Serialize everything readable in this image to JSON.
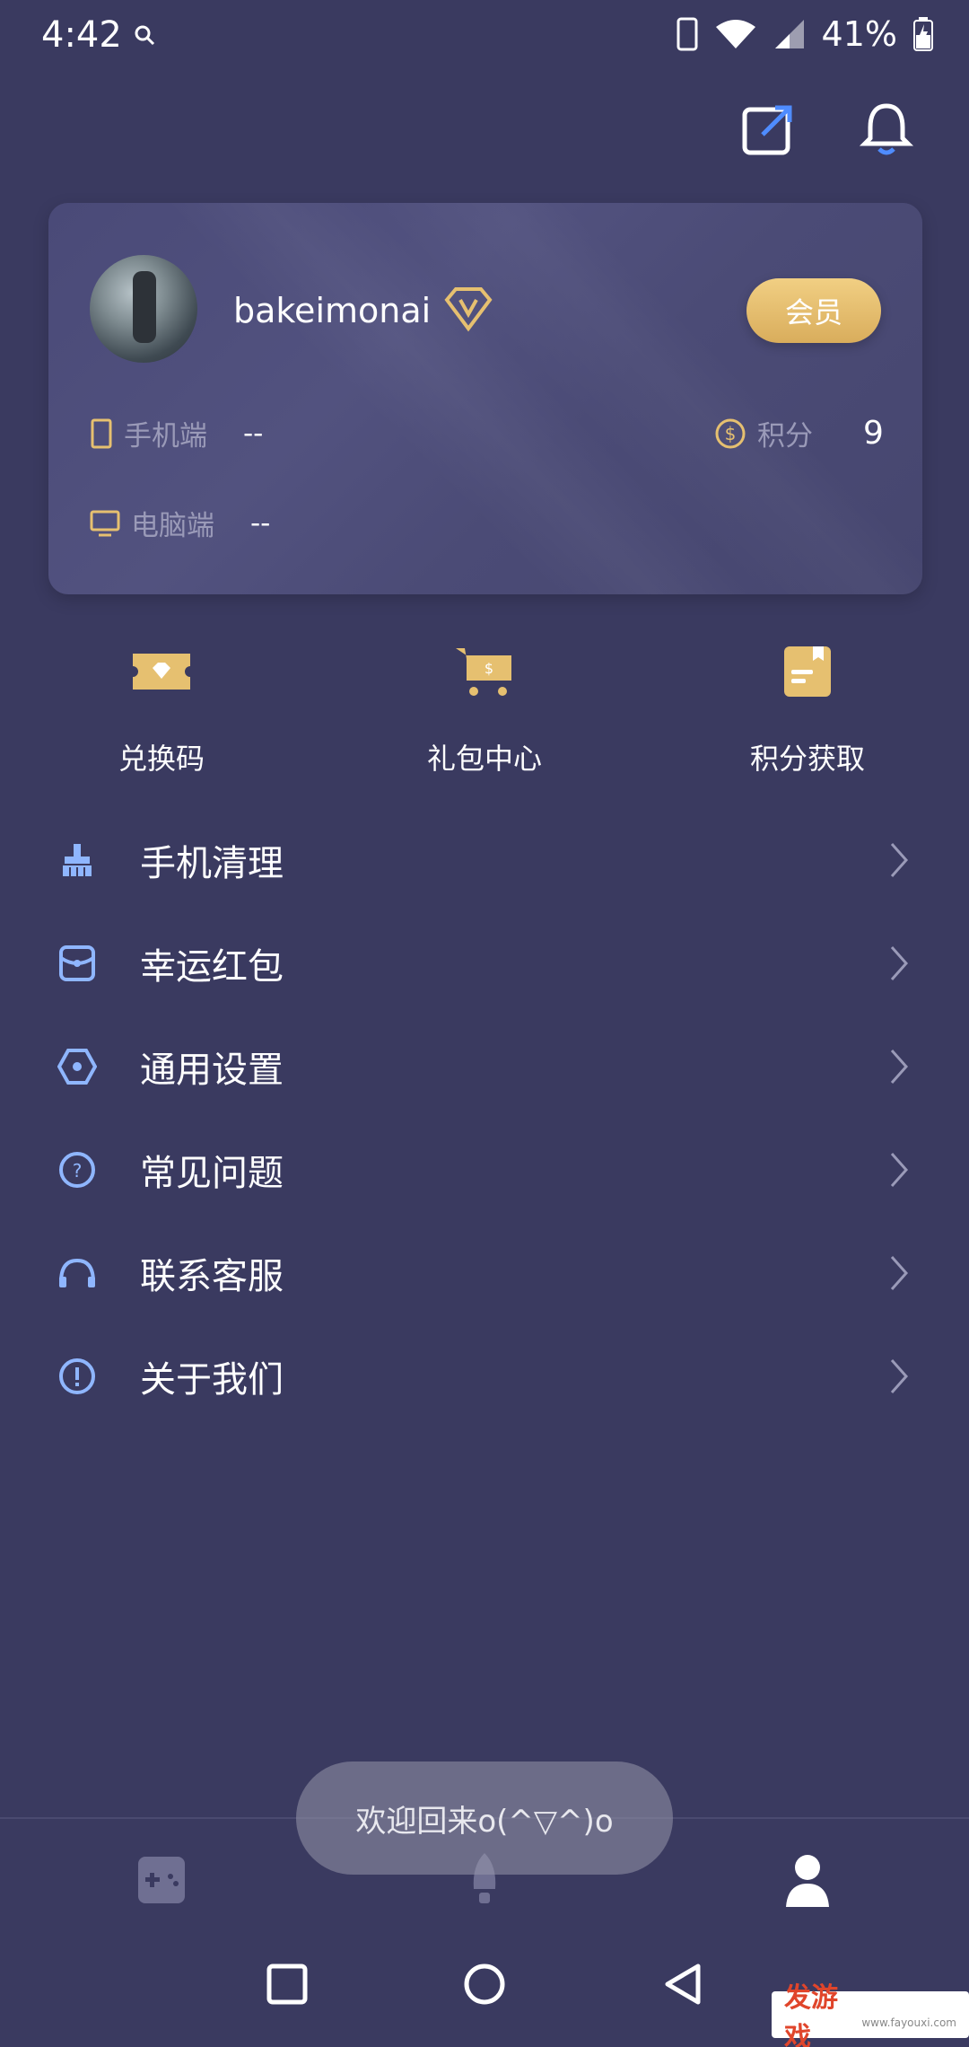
{
  "status_bar": {
    "time": "4:42",
    "battery": "41%"
  },
  "profile": {
    "username": "bakeimonai",
    "member_label": "会员",
    "phone_label": "手机端",
    "phone_value": "--",
    "pc_label": "电脑端",
    "pc_value": "--",
    "points_label": "积分",
    "points_value": "9"
  },
  "quick_actions": [
    {
      "label": "兑换码",
      "icon": "ticket-icon"
    },
    {
      "label": "礼包中心",
      "icon": "cart-icon"
    },
    {
      "label": "积分获取",
      "icon": "notes-icon"
    }
  ],
  "menu": [
    {
      "label": "手机清理",
      "icon": "broom-icon"
    },
    {
      "label": "幸运红包",
      "icon": "red-packet-icon"
    },
    {
      "label": "通用设置",
      "icon": "settings-hex-icon"
    },
    {
      "label": "常见问题",
      "icon": "question-icon"
    },
    {
      "label": "联系客服",
      "icon": "headset-icon"
    },
    {
      "label": "关于我们",
      "icon": "info-icon"
    }
  ],
  "toast": "欢迎回来o(^▽^)o",
  "tabs": [
    {
      "name": "games",
      "icon": "gamepad-icon",
      "active": false
    },
    {
      "name": "boost",
      "icon": "rocket-icon",
      "active": false
    },
    {
      "name": "me",
      "icon": "person-icon",
      "active": true
    }
  ],
  "watermark": {
    "main": "发游戏",
    "sub": "www.fayouxi.com"
  },
  "colors": {
    "background": "#3a3a60",
    "card": "#4d4d7a",
    "gold": "#e6c070",
    "menu_icon": "#8fb6ff",
    "accent_blue": "#4f8cff"
  }
}
